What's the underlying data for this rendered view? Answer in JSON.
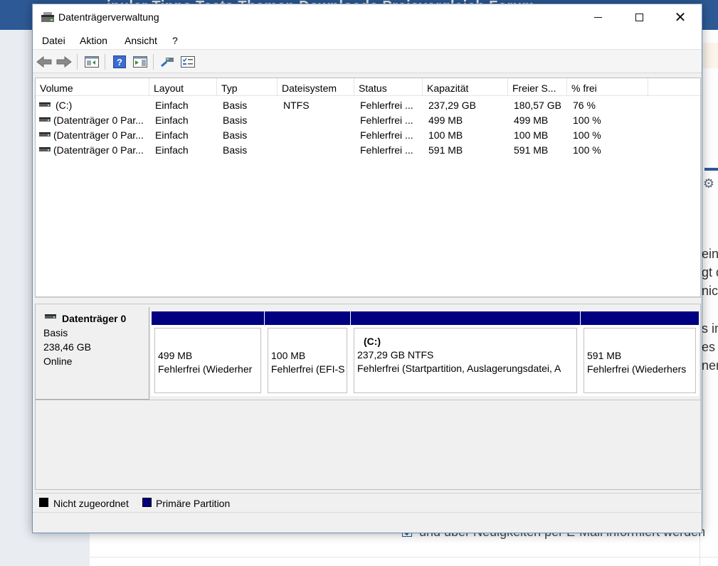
{
  "background": {
    "nav_text": "ipuler  Tipps  Tests  Themen  Downloads  Preisvergleich  Forum",
    "side_text_lines": [
      "ein",
      "gt d",
      "nic",
      "s im",
      "es",
      "ner"
    ],
    "bottom_text": "und über Neuigkeiten per E-Mail informiert werden",
    "colors": {
      "nav": "#2d5a96"
    }
  },
  "window": {
    "title": "Datenträgerverwaltung",
    "controls": {
      "minimize": "minimize",
      "maximize": "maximize",
      "close": "close"
    }
  },
  "menu": [
    "Datei",
    "Aktion",
    "Ansicht",
    "?"
  ],
  "toolbar": [
    "back-icon",
    "forward-icon",
    "console-tree-icon",
    "help-icon",
    "show-hide-icon",
    "connect-icon",
    "properties-icon"
  ],
  "volume_list": {
    "columns": [
      "Volume",
      "Layout",
      "Typ",
      "Dateisystem",
      "Status",
      "Kapazität",
      "Freier S...",
      "% frei"
    ],
    "rows": [
      {
        "volume": "(C:)",
        "layout": "Einfach",
        "typ": "Basis",
        "dateisystem": "NTFS",
        "status": "Fehlerfrei ...",
        "kapazitaet": "237,29 GB",
        "frei": "180,57 GB",
        "prozent": "76 %"
      },
      {
        "volume": "(Datenträger 0 Par...",
        "layout": "Einfach",
        "typ": "Basis",
        "dateisystem": "",
        "status": "Fehlerfrei ...",
        "kapazitaet": "499 MB",
        "frei": "499 MB",
        "prozent": "100 %"
      },
      {
        "volume": "(Datenträger 0 Par...",
        "layout": "Einfach",
        "typ": "Basis",
        "dateisystem": "",
        "status": "Fehlerfrei ...",
        "kapazitaet": "100 MB",
        "frei": "100 MB",
        "prozent": "100 %"
      },
      {
        "volume": "(Datenträger 0 Par...",
        "layout": "Einfach",
        "typ": "Basis",
        "dateisystem": "",
        "status": "Fehlerfrei ...",
        "kapazitaet": "591 MB",
        "frei": "591 MB",
        "prozent": "100 %"
      }
    ]
  },
  "disk": {
    "name": "Datenträger 0",
    "type": "Basis",
    "size": "238,46 GB",
    "state": "Online",
    "partitions": [
      {
        "label": "",
        "size": "499 MB",
        "status": "Fehlerfrei (Wiederher"
      },
      {
        "label": "",
        "size": "100 MB",
        "status": "Fehlerfrei (EFI-S"
      },
      {
        "label": "(C:)",
        "size": "237,29 GB NTFS",
        "status": "Fehlerfrei (Startpartition, Auslagerungsdatei, A"
      },
      {
        "label": "",
        "size": "591 MB",
        "status": "Fehlerfrei (Wiederhers"
      }
    ]
  },
  "legend": [
    {
      "label": "Nicht zugeordnet",
      "color": "#000000"
    },
    {
      "label": "Primäre Partition",
      "color": "#000080"
    }
  ]
}
